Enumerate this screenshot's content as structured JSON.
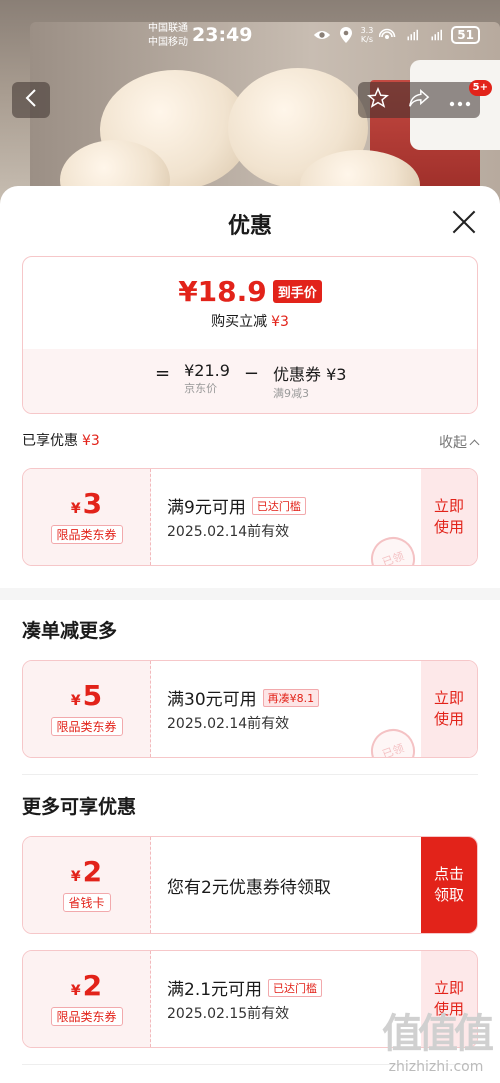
{
  "status_bar": {
    "carrier1": "中国联通",
    "carrier2": "中国移动",
    "time": "23:49",
    "net_speed": "3.3",
    "net_unit": "K/s",
    "battery": "51"
  },
  "nav": {
    "badge": "5+"
  },
  "sheet": {
    "title": "优惠",
    "summary": {
      "final_price": "¥18.9",
      "final_tag": "到手价",
      "instant_label": "购买立减",
      "instant_value": "¥3",
      "calc_eq": "=",
      "base_price": "¥21.9",
      "base_label": "京东价",
      "minus": "−",
      "coupon_label": "优惠券 ¥3",
      "coupon_sub": "满9减3"
    },
    "enjoyed_label": "已享优惠",
    "enjoyed_value": "¥3",
    "collapse_label": "收起",
    "coupons_applied": [
      {
        "symbol": "¥",
        "amount": "3",
        "kind": "限品类东券",
        "condition": "满9元可用",
        "flag": "已达门槛",
        "valid": "2025.02.14前有效",
        "action": "立即使用",
        "stamp": "已领"
      }
    ],
    "section_more_discount": "凑单减更多",
    "coupons_more": [
      {
        "symbol": "¥",
        "amount": "5",
        "kind": "限品类东券",
        "condition": "满30元可用",
        "flag": "再凑¥8.1",
        "valid": "2025.02.14前有效",
        "action": "立即使用",
        "stamp": "已领"
      }
    ],
    "section_more_available": "更多可享优惠",
    "coupons_available": [
      {
        "symbol": "¥",
        "amount": "2",
        "kind": "省钱卡",
        "text": "您有2元优惠券待领取",
        "action": "点击领取"
      },
      {
        "symbol": "¥",
        "amount": "2",
        "kind": "限品类东券",
        "condition": "满2.1元可用",
        "flag": "已达门槛",
        "valid": "2025.02.15前有效",
        "action": "立即使用"
      }
    ]
  },
  "watermark": {
    "logo": "值值值",
    "site": "zhizhizhi.com"
  },
  "colors": {
    "accent": "#e2231a",
    "tint": "#fdf2f2"
  }
}
